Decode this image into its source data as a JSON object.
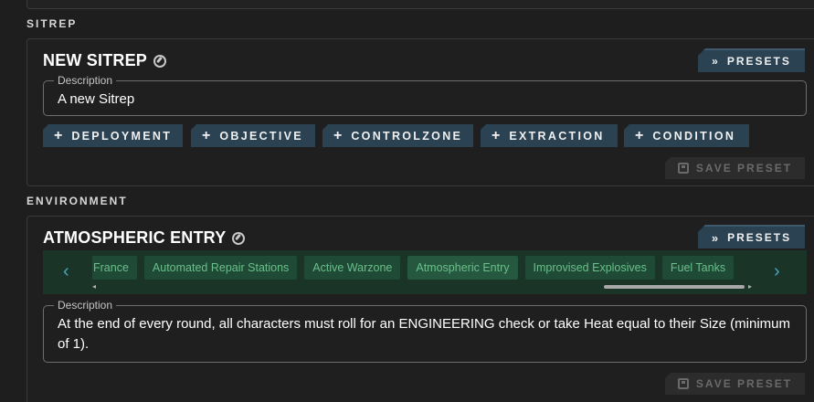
{
  "sitrep": {
    "section_label": "SITREP",
    "title": "NEW SITREP",
    "presets_label": "PRESETS",
    "description_legend": "Description",
    "description_value": "A new Sitrep",
    "add_buttons": [
      "DEPLOYMENT",
      "OBJECTIVE",
      "CONTROLZONE",
      "EXTRACTION",
      "CONDITION"
    ],
    "save_label": "SAVE PRESET"
  },
  "environment": {
    "section_label": "ENVIRONMENT",
    "title": "ATMOSPHERIC ENTRY",
    "presets_label": "PRESETS",
    "chips": [
      "France",
      "Automated Repair Stations",
      "Active Warzone",
      "Atmospheric Entry",
      "Improvised Explosives",
      "Fuel Tanks"
    ],
    "selected_chip": "Atmospheric Entry",
    "description_legend": "Description",
    "description_value": "At the end of every round, all characters must roll for an ENGINEERING check or take Heat equal to their Size (minimum of 1).",
    "save_label": "SAVE PRESET"
  },
  "colors": {
    "accent": "#2b4252",
    "chip_bg": "#1f4a35",
    "chip_text": "#6abf8b",
    "arrow": "#46a6c2"
  }
}
